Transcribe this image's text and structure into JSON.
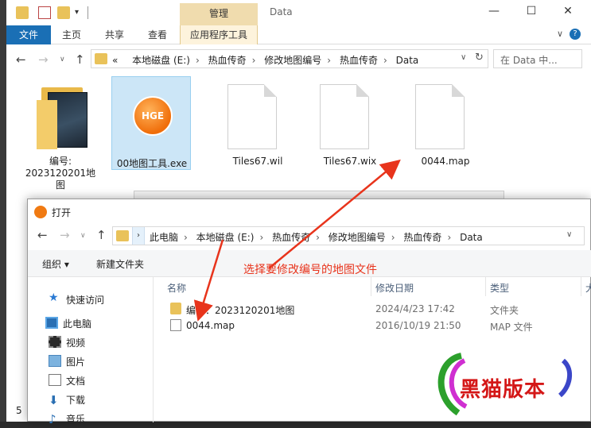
{
  "explorer": {
    "title": "Data",
    "context_tab": "管理",
    "ribbon_tabs": [
      "文件",
      "主页",
      "共享",
      "查看",
      "应用程序工具"
    ],
    "address_path": [
      "«",
      "本地磁盘 (E:)",
      "热血传奇",
      "修改地图编号",
      "热血传奇",
      "Data"
    ],
    "search_placeholder": "在 Data 中...",
    "files": [
      {
        "label": "编号:\n2023120201地\n图"
      },
      {
        "label": "00地图工具.exe",
        "logo": "HGE"
      },
      {
        "label": "Tiles67.wil"
      },
      {
        "label": "Tiles67.wix"
      },
      {
        "label": "0044.map"
      }
    ],
    "side_digit": "5"
  },
  "dialog": {
    "title": "打开",
    "address_path": [
      "此电脑",
      "本地磁盘 (E:)",
      "热血传奇",
      "修改地图编号",
      "热血传奇",
      "Data"
    ],
    "toolbar": {
      "organize": "组织 ▾",
      "new_folder": "新建文件夹"
    },
    "nav": [
      "快速访问",
      "此电脑",
      "视频",
      "图片",
      "文档",
      "下载",
      "音乐"
    ],
    "headers": {
      "name": "名称",
      "date": "修改日期",
      "type": "类型",
      "size": "大"
    },
    "rows": [
      {
        "name": "编号：2023120201地图",
        "date": "2024/4/23 17:42",
        "type": "文件夹",
        "icon": "folder-icon"
      },
      {
        "name": "0044.map",
        "date": "2016/10/19 21:50",
        "type": "MAP 文件",
        "icon": "file-icon"
      }
    ]
  },
  "annotation": {
    "text": "选择要修改编号的地图文件",
    "color": "#e8341c"
  },
  "watermark": {
    "text": "黑猫版本"
  }
}
